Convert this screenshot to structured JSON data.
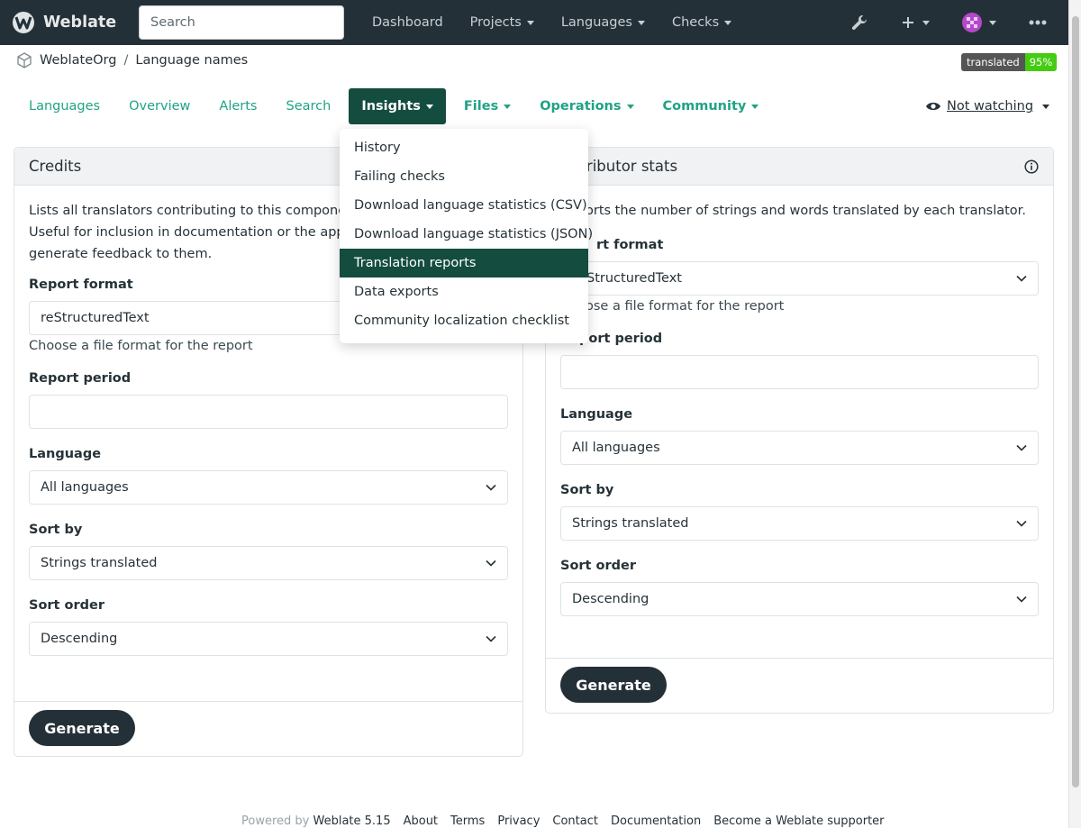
{
  "navbar": {
    "brand": "Weblate",
    "search_placeholder": "Search",
    "items": [
      {
        "label": "Dashboard",
        "caret": false
      },
      {
        "label": "Projects",
        "caret": true
      },
      {
        "label": "Languages",
        "caret": true
      },
      {
        "label": "Checks",
        "caret": true
      }
    ],
    "right_icons": [
      "wrench-icon",
      "plus-icon",
      "avatar-icon",
      "more-icon"
    ]
  },
  "breadcrumb": {
    "project": "WeblateOrg",
    "separator": "/",
    "component": "Language names"
  },
  "status_badge": {
    "label": "translated",
    "value": "95%"
  },
  "tabs": [
    {
      "label": "Languages",
      "caret": false,
      "active": false
    },
    {
      "label": "Overview",
      "caret": false,
      "active": false
    },
    {
      "label": "Alerts",
      "caret": false,
      "active": false
    },
    {
      "label": "Search",
      "caret": false,
      "active": false
    },
    {
      "label": "Insights",
      "caret": true,
      "active": true
    },
    {
      "label": "Files",
      "caret": true,
      "active": false
    },
    {
      "label": "Operations",
      "caret": true,
      "active": false
    },
    {
      "label": "Community",
      "caret": true,
      "active": false
    }
  ],
  "watch": {
    "label": "Not watching"
  },
  "insights_menu": [
    "History",
    "Failing checks",
    "Download language statistics (CSV)",
    "Download language statistics (JSON)",
    "Translation reports",
    "Data exports",
    "Community localization checklist"
  ],
  "credits": {
    "title": "Credits",
    "description_line1": "Lists all translators contributing to this component i",
    "description_line2": "Useful for inclusion in documentation or the app itse",
    "description_line3": "generate feedback to them.",
    "report_format_label": "Report format",
    "report_format_value": "reStructuredText",
    "report_format_help": "Choose a file format for the report",
    "report_period_label": "Report period",
    "language_label": "Language",
    "language_value": "All languages",
    "sort_by_label": "Sort by",
    "sort_by_value": "Strings translated",
    "sort_order_label": "Sort order",
    "sort_order_value": "Descending",
    "generate_label": "Generate"
  },
  "stats": {
    "title": "ntributor stats",
    "description": "orts the number of strings and words translated by each translator.",
    "report_format_label": "rt format",
    "report_format_value": "StructuredText",
    "report_format_help": "ose a file format for the report",
    "report_period_label": "Report period",
    "language_label": "Language",
    "language_value": "All languages",
    "sort_by_label": "Sort by",
    "sort_by_value": "Strings translated",
    "sort_order_label": "Sort order",
    "sort_order_value": "Descending",
    "generate_label": "Generate"
  },
  "footer": {
    "powered_by": "Powered by",
    "version": "Weblate 5.15",
    "links": [
      "About",
      "Terms",
      "Privacy",
      "Contact",
      "Documentation",
      "Become a Weblate supporter"
    ]
  },
  "colors": {
    "accent": "#1fa385",
    "active_tab": "#144d3f",
    "navbar": "#243038",
    "badge_green": "#44cc11"
  }
}
